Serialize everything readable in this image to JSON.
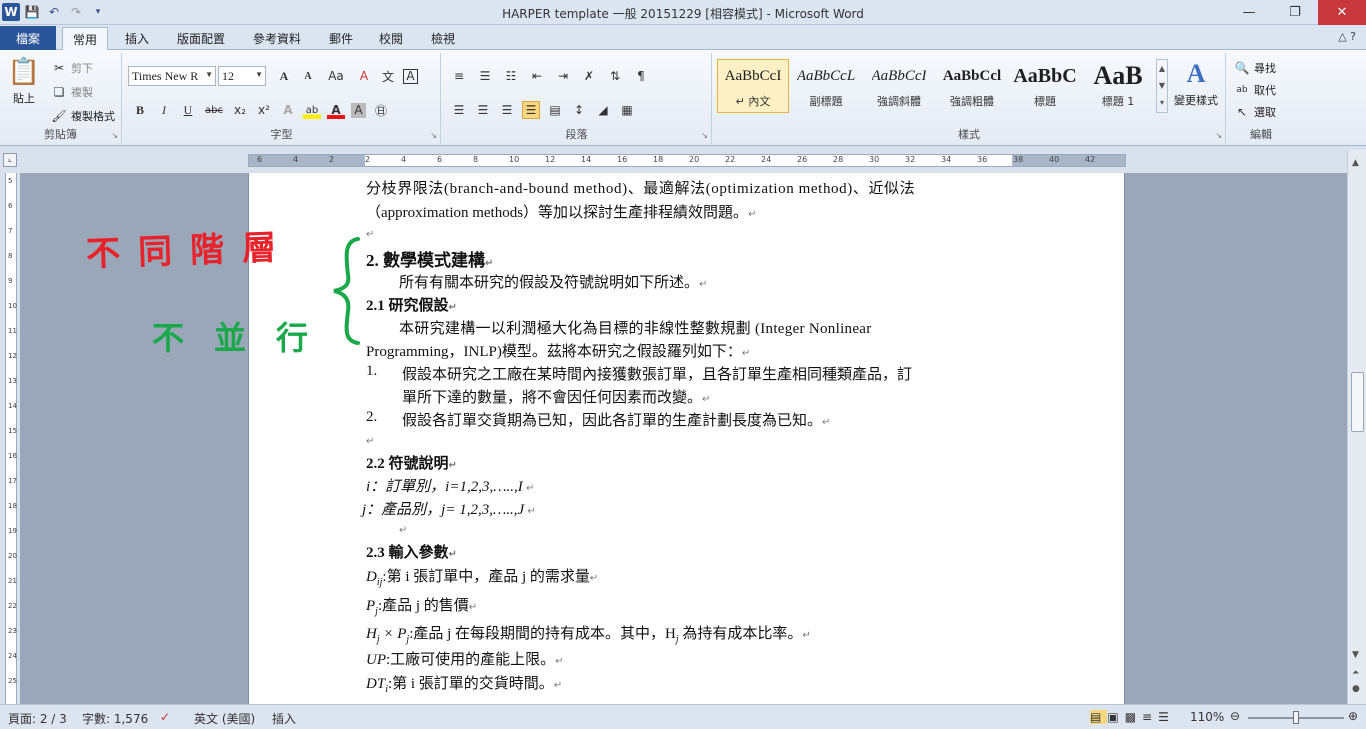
{
  "window": {
    "title": "HARPER template 一般 20151229 [相容模式] - Microsoft Word",
    "app_icon": "W"
  },
  "tabs": [
    "檔案",
    "常用",
    "插入",
    "版面配置",
    "參考資料",
    "郵件",
    "校閱",
    "檢視"
  ],
  "ribbon": {
    "clipboard": {
      "paste": "貼上",
      "cut": "剪下",
      "copy": "複製",
      "format_painter": "複製格式",
      "label": "剪貼簿"
    },
    "font": {
      "name": "Times New R",
      "size": "12",
      "label": "字型",
      "bold": "B",
      "italic": "I",
      "underline": "U",
      "strike": "abc",
      "sub": "x₂",
      "sup": "x²",
      "grow": "A",
      "shrink": "A",
      "case": "Aa",
      "clear": "A",
      "font_color": "A",
      "highlight": "ab"
    },
    "paragraph": {
      "label": "段落"
    },
    "styles": {
      "label": "樣式",
      "items": [
        {
          "preview": "AaBbCcI",
          "name": "↵ 內文",
          "selected": true
        },
        {
          "preview": "AaBbCcL",
          "name": "副標題"
        },
        {
          "preview": "AaBbCcI",
          "name": "強調斜體"
        },
        {
          "preview": "AaBbCcl",
          "name": "強調粗體"
        },
        {
          "preview": "AaBbC",
          "name": "標題"
        },
        {
          "preview": "AaB",
          "name": "標題 1"
        }
      ],
      "change": "變更樣式"
    },
    "editing": {
      "label": "編輯",
      "find": "尋找",
      "replace": "取代",
      "select": "選取"
    }
  },
  "ruler": {
    "h_numbers": [
      "6",
      "4",
      "2",
      "2",
      "4",
      "6",
      "8",
      "10",
      "12",
      "14",
      "16",
      "18",
      "20",
      "22",
      "24",
      "26",
      "28",
      "30",
      "32",
      "34",
      "36",
      "38",
      "40",
      "42"
    ],
    "v_numbers": [
      "5",
      "6",
      "7",
      "8",
      "9",
      "10",
      "11",
      "12",
      "13",
      "14",
      "15",
      "16",
      "17",
      "18",
      "19",
      "20",
      "21",
      "22",
      "23",
      "24",
      "25"
    ]
  },
  "document": {
    "lines": [
      "分枝界限法(branch-and-bound  method)、最適解法(optimization  method)、近似法",
      "（approximation methods）等加以探討生產排程績效問題。",
      "",
      "2.  數學模式建構",
      "所有有關本研究的假設及符號說明如下所述。",
      "2.1  研究假設",
      "本研究建構一以利潤極大化為目標的非線性整數規劃  (Integer  Nonlinear",
      "Programming，INLP)模型。茲將本研究之假設羅列如下：",
      "1.",
      "假設本研究之工廠在某時間內接獲數張訂單，且各訂單生產相同種類產品，訂",
      "單所下達的數量，將不會因任何因素而改變。",
      "2.",
      "假設各訂單交貨期為已知，因此各訂單的生產計劃長度為已知。",
      "",
      "2.2  符號說明",
      "i：訂單別，i=1,2,3,…..,I",
      "j：產品別，j= 1,2,3,…..,J",
      "",
      "2.3 輸入參數",
      "D",
      "ij",
      ":第 i 張訂單中，產品 j 的需求量",
      "P",
      "j",
      ":產品 j 的售價",
      "H",
      "j",
      " × P",
      "j",
      ":產品 j 在每段期間的持有成本。其中，H",
      "j",
      " 為持有成本比率。",
      "UP",
      ":工廠可使用的產能上限。",
      "DT",
      "i",
      ":第 i 張訂單的交貨時間。"
    ]
  },
  "annotations": {
    "line1": "不同階層",
    "line2": "不並行",
    "color1": "#e8222a",
    "color2": "#1aa84a"
  },
  "status": {
    "page": "頁面: 2 / 3",
    "words": "字數: 1,576",
    "language": "英文 (美國)",
    "mode": "插入",
    "zoom": "110%"
  }
}
